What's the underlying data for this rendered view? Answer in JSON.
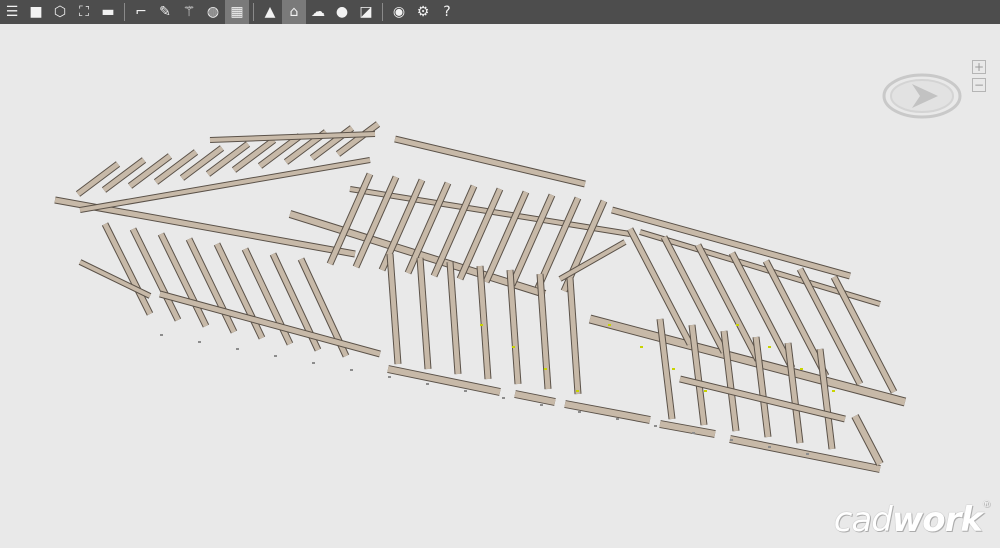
{
  "toolbar": {
    "groups": [
      [
        {
          "icon": "menu-icon",
          "glyph": "☰"
        },
        {
          "icon": "cube-solid-icon",
          "glyph": "■"
        },
        {
          "icon": "cube-wireframe-icon",
          "glyph": "⬡"
        },
        {
          "icon": "fullscreen-icon",
          "glyph": "⛶"
        },
        {
          "icon": "shading-icon",
          "glyph": "▬"
        }
      ],
      [
        {
          "icon": "dimension-icon",
          "glyph": "⌐"
        },
        {
          "icon": "pencil-icon",
          "glyph": "✎"
        },
        {
          "icon": "wand-icon",
          "glyph": "⚚"
        },
        {
          "icon": "component-icon",
          "glyph": "◍"
        },
        {
          "icon": "pattern-icon",
          "glyph": "▦",
          "active": true
        }
      ],
      [
        {
          "icon": "terrain-icon",
          "glyph": "▲"
        },
        {
          "icon": "home-icon",
          "glyph": "⌂",
          "active": true
        },
        {
          "icon": "weather-icon",
          "glyph": "☁"
        },
        {
          "icon": "light-bulb-icon",
          "glyph": "●"
        },
        {
          "icon": "shield-icon",
          "glyph": "◪"
        }
      ],
      [
        {
          "icon": "eye-icon",
          "glyph": "◉"
        },
        {
          "icon": "gear-icon",
          "glyph": "⚙"
        },
        {
          "icon": "help-icon",
          "glyph": "?"
        }
      ]
    ]
  },
  "zoom": {
    "plus": "+",
    "minus": "−"
  },
  "logo": {
    "part1": "cad",
    "part2": "work",
    "mark": "®"
  },
  "colors": {
    "wood": "#c7b9a8",
    "wood_dark": "#5b5249",
    "plate": "#b9aa98",
    "connector": "#c8d400"
  }
}
